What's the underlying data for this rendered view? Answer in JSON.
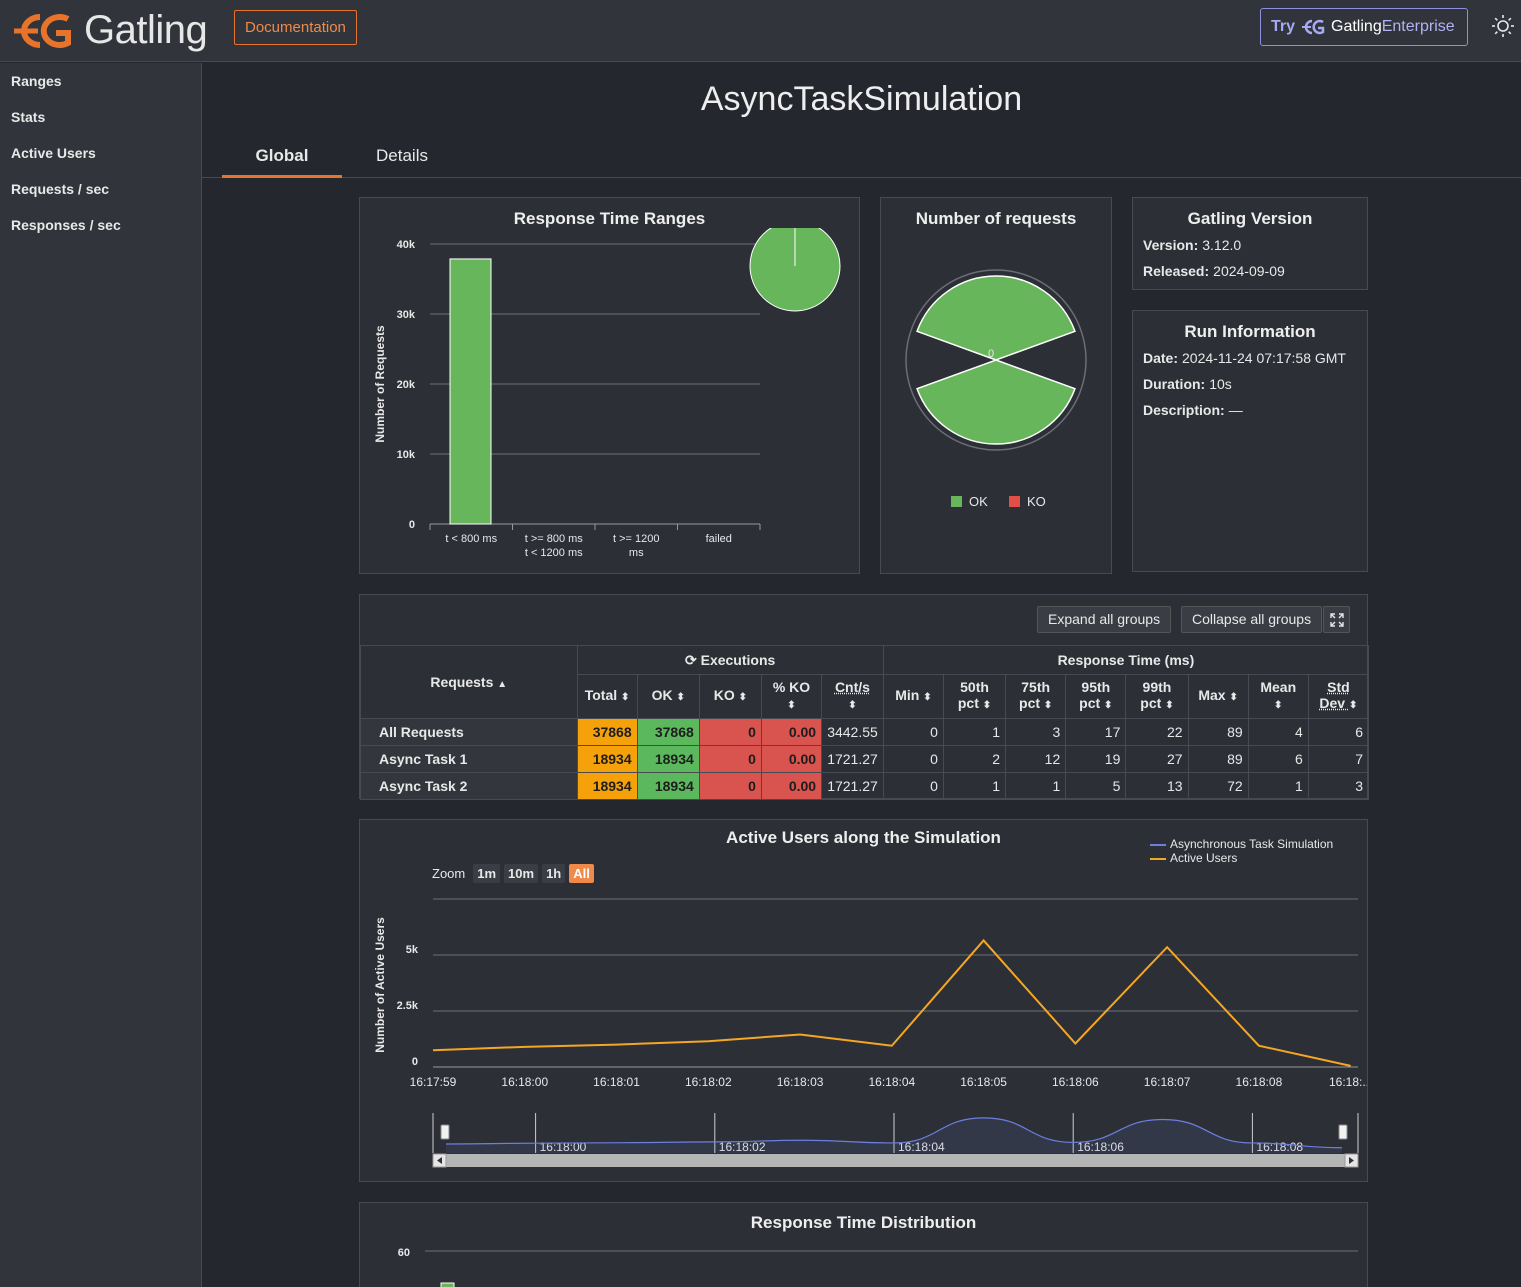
{
  "app": {
    "brand": "Gatling",
    "doc_label": "Documentation",
    "enterprise": {
      "try": "Try",
      "gatling": "Gatling",
      "enterprise": "Enterprise"
    },
    "accent": "#e8742b"
  },
  "sidebar": {
    "items": [
      {
        "label": "Ranges"
      },
      {
        "label": "Stats"
      },
      {
        "label": "Active Users"
      },
      {
        "label": "Requests / sec"
      },
      {
        "label": "Responses / sec"
      }
    ]
  },
  "page": {
    "title": "AsyncTaskSimulation",
    "tabs": [
      {
        "label": "Global"
      },
      {
        "label": "Details"
      }
    ]
  },
  "version_card": {
    "title": "Gatling Version",
    "version_label": "Version:",
    "version": "3.12.0",
    "released_label": "Released:",
    "released": "2024-09-09"
  },
  "run_card": {
    "title": "Run Information",
    "date_label": "Date:",
    "date": "2024-11-24 07:17:58 GMT",
    "duration_label": "Duration:",
    "duration": "10s",
    "description_label": "Description:",
    "description": "—"
  },
  "stats": {
    "expand_label": "Expand all groups",
    "collapse_label": "Collapse all groups",
    "requests_header": "Requests",
    "executions_header": "Executions",
    "response_header": "Response Time (ms)",
    "columns": [
      "Total",
      "OK",
      "KO",
      "% KO",
      "Cnt/s",
      "Min",
      "50th pct",
      "75th pct",
      "95th pct",
      "99th pct",
      "Max",
      "Mean",
      "Std Dev"
    ],
    "col_lines": [
      [
        "Total"
      ],
      [
        "OK"
      ],
      [
        "KO"
      ],
      [
        "% KO",
        ""
      ],
      [
        "Cnt/s",
        ""
      ],
      [
        "Min"
      ],
      [
        "50th",
        "pct"
      ],
      [
        "75th",
        "pct"
      ],
      [
        "95th",
        "pct"
      ],
      [
        "99th",
        "pct"
      ],
      [
        "Max"
      ],
      [
        "Mean",
        ""
      ],
      [
        "Std",
        "Dev"
      ]
    ],
    "rows": [
      {
        "name": "All Requests",
        "values": [
          "37868",
          "37868",
          "0",
          "0.00",
          "3442.55",
          "0",
          "1",
          "3",
          "17",
          "22",
          "89",
          "4",
          "6"
        ]
      },
      {
        "name": "Async Task 1",
        "values": [
          "18934",
          "18934",
          "0",
          "0.00",
          "1721.27",
          "0",
          "2",
          "12",
          "19",
          "27",
          "89",
          "6",
          "7"
        ]
      },
      {
        "name": "Async Task 2",
        "values": [
          "18934",
          "18934",
          "0",
          "0.00",
          "1721.27",
          "0",
          "1",
          "1",
          "5",
          "13",
          "72",
          "1",
          "3"
        ]
      }
    ]
  },
  "chart_data": [
    {
      "type": "bar",
      "title": "Response Time Ranges",
      "ylabel": "Number of Requests",
      "categories": [
        [
          "t < 800 ms"
        ],
        [
          "t >= 800 ms",
          "t < 1200 ms"
        ],
        [
          "t >= 1200",
          "ms"
        ],
        [
          "failed"
        ]
      ],
      "values": [
        37868,
        0,
        0,
        0
      ],
      "ylim": [
        0,
        40000
      ],
      "yticks": [
        "0",
        "10k",
        "20k",
        "30k",
        "40k"
      ],
      "yticks_values": [
        0,
        10000,
        20000,
        30000,
        40000
      ],
      "pie": {
        "values": [
          37868,
          0
        ]
      },
      "colors": {
        "bar": "#68b65c"
      }
    },
    {
      "type": "pie",
      "title": "Number of requests",
      "center_label": "0",
      "slices": [
        {
          "name": "OK",
          "value": 37868,
          "color": "#68b65c"
        },
        {
          "name": "KO",
          "value": 0,
          "color": "#e34f46"
        }
      ],
      "legend": [
        {
          "name": "OK",
          "color": "#68b65c"
        },
        {
          "name": "KO",
          "color": "#e34f46"
        }
      ]
    },
    {
      "type": "line",
      "title": "Active Users along the Simulation",
      "ylabel": "Number of Active Users",
      "zoom_label": "Zoom",
      "zoom_buttons": [
        "1m",
        "10m",
        "1h",
        "All"
      ],
      "x": [
        "16:17:59",
        "16:18:00",
        "16:18:01",
        "16:18:02",
        "16:18:03",
        "16:18:04",
        "16:18:05",
        "16:18:06",
        "16:18:07",
        "16:18:08",
        "16:18:..."
      ],
      "ylim": [
        0,
        7500
      ],
      "yticks": [
        "0",
        "2.5k",
        "5k"
      ],
      "yticks_values": [
        0,
        2500,
        5000
      ],
      "series": [
        {
          "name": "Asynchronous Task Simulation",
          "color": "#6b7fe0",
          "values": []
        },
        {
          "name": "Active Users",
          "color": "#f5a623",
          "values": [
            750,
            900,
            1000,
            1150,
            1450,
            950,
            5650,
            1050,
            5350,
            950,
            50
          ]
        }
      ],
      "navigator_labels": [
        "16:18:00",
        "16:18:02",
        "16:18:04",
        "16:18:06",
        "16:18:08"
      ]
    },
    {
      "type": "bar",
      "title": "Response Time Distribution",
      "yticks": [
        "60"
      ]
    }
  ]
}
